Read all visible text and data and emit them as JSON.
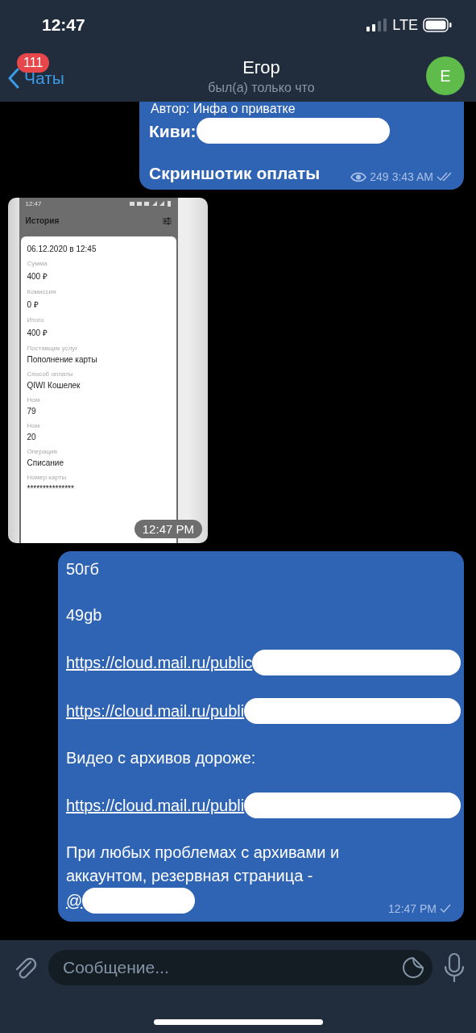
{
  "status_bar": {
    "time": "12:47",
    "network": "LTE"
  },
  "header": {
    "back_label": "Чаты",
    "unread_badge": "111",
    "title": "Егор",
    "subtitle": "был(а) только что",
    "avatar_letter": "Е"
  },
  "messages": [
    {
      "kind": "text",
      "author": "Автор: Инфа о приватке",
      "paragraphs": [
        {
          "kind": "text",
          "text": "Киви:",
          "bold": true,
          "redacted": true
        },
        {
          "kind": "text",
          "text": "Скриншотик оплаты",
          "bold": true
        }
      ],
      "views": "249",
      "time": "3:43 AM",
      "read": true
    },
    {
      "kind": "image",
      "time": "12:47 PM",
      "screenshot": {
        "time": "12:47",
        "title": "История",
        "date": "06.12.2020 в 12:45",
        "fields": [
          {
            "label": "Сумма",
            "value": "400 ₽"
          },
          {
            "label": "Комиссия",
            "value": "0 ₽"
          },
          {
            "label": "Итого",
            "value": "400 ₽"
          },
          {
            "label": "Поставщик услуг",
            "value": "Пополнение карты"
          },
          {
            "label": "Способ оплаты",
            "value": "QIWI Кошелек"
          },
          {
            "label": "Ном",
            "value": "79"
          },
          {
            "label": "Ном",
            "value": "20"
          },
          {
            "label": "Операция",
            "value": "Списание"
          },
          {
            "label": "Номер карты",
            "value": "***************"
          }
        ]
      }
    },
    {
      "kind": "text",
      "paragraphs": [
        {
          "kind": "text",
          "text": "50гб",
          "bold": false
        },
        {
          "kind": "text",
          "text": "49gb",
          "bold": false
        },
        {
          "kind": "link",
          "text": "https://cloud.mail.ru/public",
          "redacted": true
        },
        {
          "kind": "link",
          "text": "https://cloud.mail.ru/publi",
          "redacted": true
        },
        {
          "kind": "text",
          "text": "Видео с архивов дороже:",
          "bold": false
        },
        {
          "kind": "link",
          "text": "https://cloud.mail.ru/publi",
          "redacted": true
        },
        {
          "kind": "text",
          "text": "При любых проблемах с архивами и аккаунтом, резервная страница -",
          "bold": false
        },
        {
          "kind": "link",
          "text": "@",
          "redacted": true,
          "joined": true
        }
      ],
      "time": "12:47 PM",
      "read": false
    }
  ],
  "composer": {
    "placeholder": "Сообщение..."
  }
}
